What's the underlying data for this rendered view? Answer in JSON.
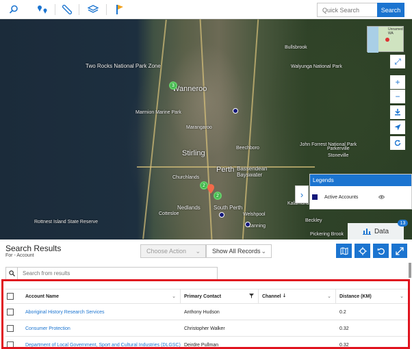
{
  "toolbar": {
    "icons": [
      "search-icon",
      "pins-icon",
      "ruler-icon",
      "layers-icon",
      "flag-icon"
    ],
    "quick_search_placeholder": "Quick Search",
    "search_button": "Search"
  },
  "map": {
    "labels": [
      "Two Rocks National Park Zone",
      "Wanneroo",
      "Marmion Marine Park",
      "Stirling",
      "Perth",
      "Bassendean",
      "Bayswater",
      "Churchlands",
      "Nedlands",
      "South Perth",
      "Cottesloe",
      "Welshpool",
      "Canning",
      "Kalamunda",
      "Rottnest Island State Reserve",
      "Bullsbrook",
      "Walyunga National Park",
      "Marangaroo",
      "Beechboro",
      "Parkerville",
      "Stoneville",
      "John Forrest National Park",
      "Beckley",
      "Pickering Brook",
      "Unnamed WA"
    ],
    "controls": [
      "expand-icon",
      "zoom-in-icon",
      "zoom-out-icon",
      "download-icon",
      "locate-icon",
      "refresh-icon"
    ],
    "clusters": [
      "3",
      "2",
      "2"
    ]
  },
  "legend": {
    "title": "Legends",
    "item_label": "Active Accounts",
    "item_color": "#14187a"
  },
  "data_tab": {
    "label": "Data",
    "count": "13"
  },
  "results": {
    "title": "Search Results",
    "subtitle": "For - Account",
    "choose_action": "Choose Action",
    "record_filter": "Show All Records",
    "search_placeholder": "Search from results"
  },
  "grid": {
    "columns": [
      "Account Name",
      "Primary Contact",
      "Channel",
      "Distance (KM)"
    ],
    "rows": [
      {
        "account": "Aboriginal History Research Services",
        "contact": "Anthony Hudson",
        "channel": "",
        "distance": "0.2"
      },
      {
        "account": "Consumer Protection",
        "contact": "Christopher Walker",
        "channel": "",
        "distance": "0.32"
      },
      {
        "account": "Department of Local Government, Sport and Cultural Industries (DLGSC)",
        "contact": "Deirdre Pullman",
        "channel": "",
        "distance": "0.32"
      }
    ]
  },
  "colors": {
    "accent": "#1b74d0",
    "highlight": "#e0131e",
    "cluster": "#3fb54a"
  }
}
